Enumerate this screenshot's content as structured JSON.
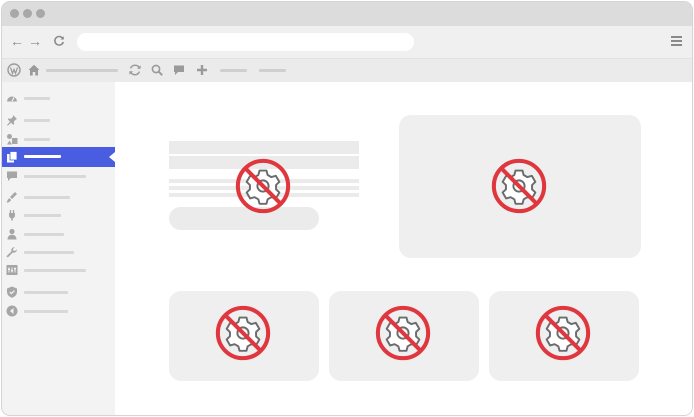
{
  "browser": {
    "window_controls": [
      "close",
      "minimize",
      "maximize"
    ],
    "nav_buttons": [
      "back-arrow-icon",
      "forward-arrow-icon",
      "reload-icon"
    ],
    "url": "",
    "menu_icon": "hamburger-menu-icon"
  },
  "adminbar": {
    "icons": [
      "wordpress-logo-icon",
      "home-icon",
      "refresh-icon",
      "search-icon",
      "comment-icon",
      "plus-icon"
    ]
  },
  "sidebar": {
    "active_index": 3,
    "items": [
      {
        "icon": "dashboard-icon"
      },
      {
        "icon": "pin-icon"
      },
      {
        "icon": "media-icon"
      },
      {
        "icon": "pages-icon",
        "active": true
      },
      {
        "icon": "comment-icon"
      },
      {
        "icon": "appearance-icon"
      },
      {
        "icon": "plugins-icon"
      },
      {
        "icon": "users-icon"
      },
      {
        "icon": "tools-icon"
      },
      {
        "icon": "settings-icon"
      },
      {
        "icon": "shield-icon"
      },
      {
        "icon": "collapse-icon"
      }
    ]
  },
  "content": {
    "blocked_icon": "no-settings-icon",
    "colors": {
      "prohibit_red": "#e0373f",
      "gear_gray": "#6b6b6b",
      "card_bg": "#efefef",
      "active_blue": "#4a5ce0"
    }
  }
}
